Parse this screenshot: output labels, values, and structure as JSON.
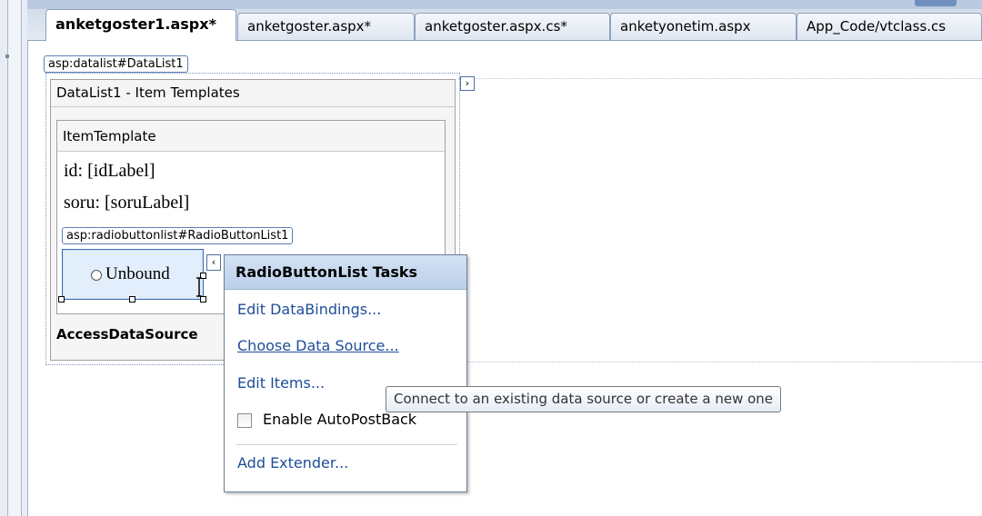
{
  "tabs": [
    {
      "label": "anketgoster1.aspx*",
      "active": true
    },
    {
      "label": "anketgoster.aspx*",
      "active": false
    },
    {
      "label": "anketgoster.aspx.cs*",
      "active": false
    },
    {
      "label": "anketyonetim.aspx",
      "active": false
    },
    {
      "label": "App_Code/vtclass.cs",
      "active": false
    }
  ],
  "designer": {
    "datalist_tag": "asp:datalist#DataList1",
    "datalist_header": "DataList1 - Item Templates",
    "item_template_header": "ItemTemplate",
    "id_line": "id: [idLabel]",
    "soru_line": "soru: [soruLabel]",
    "radio_tag": "asp:radiobuttonlist#RadioButtonList1",
    "radio_item": "Unbound",
    "access_ds": "AccessDataSource"
  },
  "tasks_popup": {
    "title": "RadioButtonList Tasks",
    "edit_databindings": "Edit DataBindings...",
    "choose_data_source": "Choose Data Source...",
    "edit_items": "Edit Items...",
    "enable_autopostback": "Enable AutoPostBack",
    "autopostback_checked": false,
    "add_extender": "Add Extender..."
  },
  "tooltip": "Connect to an existing data source or create a new one",
  "icons": {
    "smart_tag_collapse": "›",
    "smart_tag_expand": "‹"
  }
}
